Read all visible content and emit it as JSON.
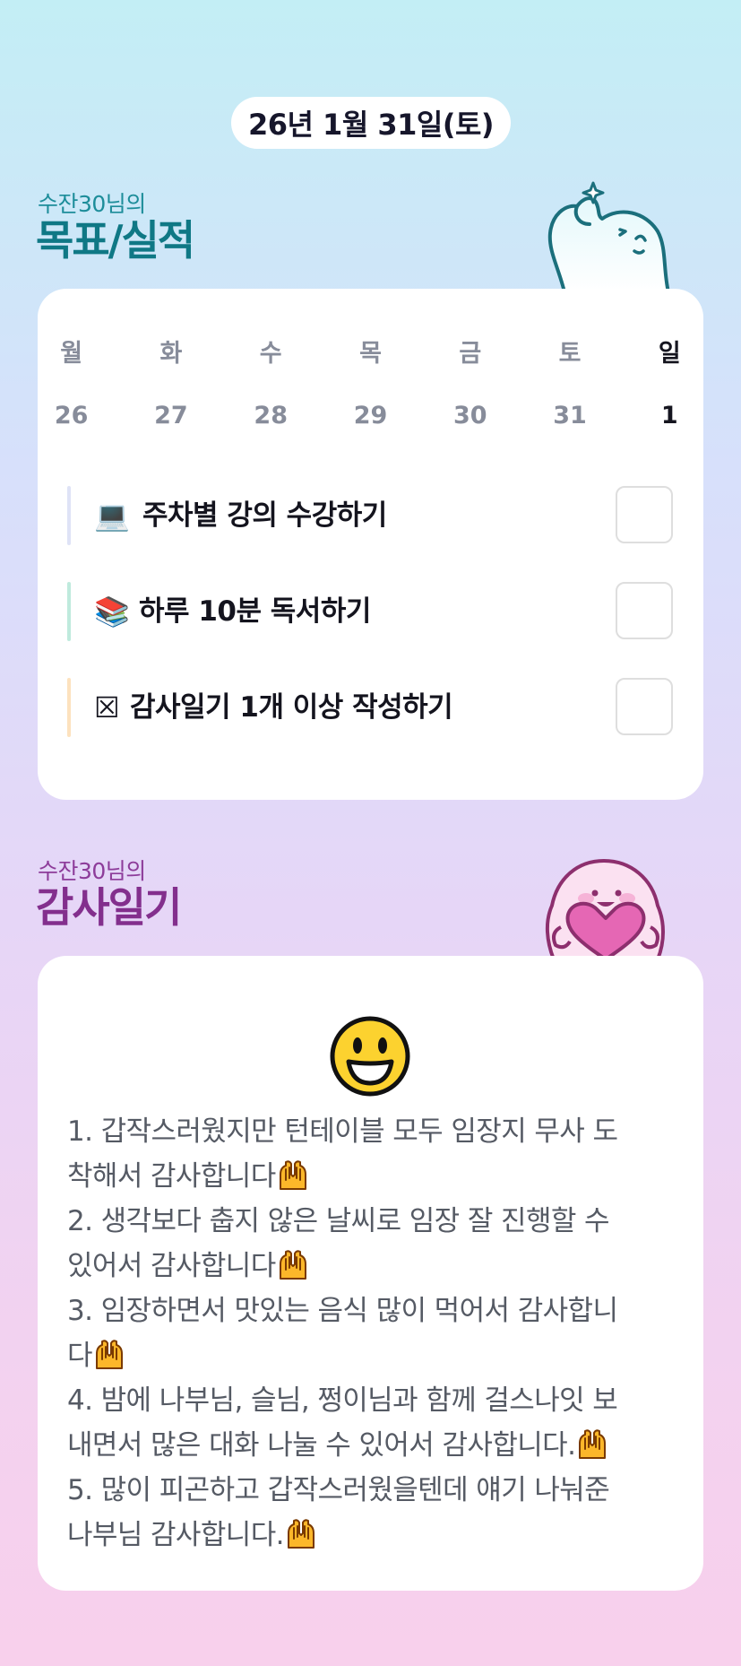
{
  "header": {
    "date": "26년 1월 31일(토)"
  },
  "goals_section": {
    "subtitle": "수잔30님의",
    "title": "목표/실적"
  },
  "week": {
    "days": [
      "월",
      "화",
      "수",
      "목",
      "금",
      "토",
      "일"
    ],
    "dates": [
      "26",
      "27",
      "28",
      "29",
      "30",
      "31",
      "1"
    ],
    "today_index": 6
  },
  "goals": [
    {
      "emoji": "💻",
      "label": "주차별 강의 수강하기",
      "bar_color": "#dfe3f6",
      "checked": false
    },
    {
      "emoji": "📚",
      "label": "하루 10분 독서하기",
      "bar_color": "#bfeadd",
      "checked": false
    },
    {
      "emoji": "☒",
      "label": "감사일기 1개 이상 작성하기",
      "bar_color": "#fde2be",
      "checked": false
    }
  ],
  "diary_section": {
    "subtitle": "수잔30님의",
    "title": "감사일기"
  },
  "diary": {
    "mood_icon": "grinning-face-icon",
    "lines": [
      "1. 갑작스러웠지만 턴테이블 모두 임장지 무사 도",
      "착해서 감사합니다",
      "2. 생각보다 춥지 않은 날씨로 임장 잘 진행할 수",
      "있어서 감사합니다",
      "3. 임장하면서 맛있는 음식 많이 먹어서 감사합니",
      "다",
      "4. 밤에 나부님, 슬님, 쩡이님과 함께 걸스나잇 보",
      "내면서 많은 대화 나눌 수 있어서 감사합니다.",
      "5. 많이 피곤하고 갑작스러웠을텐데 얘기 나눠준",
      "나부님 감사합니다."
    ]
  },
  "colors": {
    "teal_title": "#0f7885",
    "purple_title": "#832f8d",
    "card_bg": "#ffffff"
  }
}
